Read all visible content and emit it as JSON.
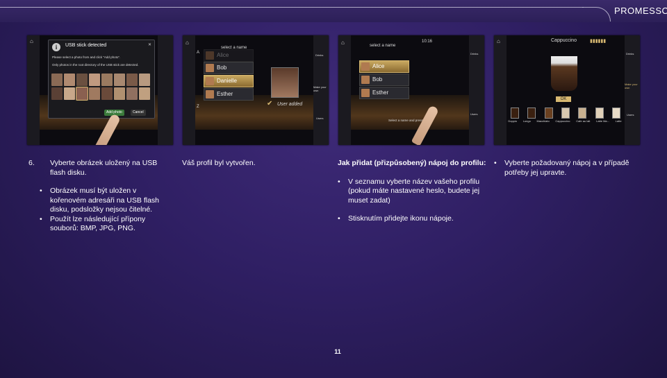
{
  "header": {
    "brand": "PROMESSO"
  },
  "screenshots": {
    "s1": {
      "dialog_title": "USB stick detected",
      "line1": "Please select a photo from and click \"Add photo\".",
      "line2": "Only photos in the root directory of the USB stick are detected.",
      "add_label": "Add photo",
      "cancel_label": "Cancel"
    },
    "s2": {
      "select_prompt": "select a name",
      "names": [
        "Alice",
        "Bob",
        "Danielle",
        "Esther"
      ],
      "user_added": "User added",
      "make_your_own": "Make your own",
      "drinks": "Drinks",
      "users": "Users"
    },
    "s3": {
      "time": "10:16",
      "select_prompt": "select a name",
      "names": [
        "Alice",
        "Bob",
        "Esther"
      ],
      "hint": "Select a name and press OK",
      "drinks": "Drinks",
      "users": "Users"
    },
    "s4": {
      "title": "Cappuccino",
      "ok": "OK",
      "drinks": [
        "Doppio",
        "Lungo",
        "Macchiato",
        "Cappuccino",
        "Cafe au lait",
        "Latte Ma...",
        "Latte"
      ],
      "side_drinks": "Drinks",
      "make_your_own": "Make your own",
      "users": "Users"
    }
  },
  "columns": {
    "c1": {
      "step": "6.",
      "main": "Vyberte obrázek uložený na USB flash disku.",
      "bullets": [
        "Obrázek musí být uložen v kořenovém adresáři na USB flash disku, podsložky nejsou čitelné.",
        "Použít lze následující přípony souborů: BMP, JPG, PNG."
      ]
    },
    "c2": {
      "text": "Váš profil byl vytvořen."
    },
    "c3": {
      "heading": "Jak přidat (přizpůsobený) nápoj do profilu:",
      "bullets": [
        "V seznamu vyberte název vašeho profilu (pokud máte nastavené heslo, budete jej muset zadat)",
        "Stisknutím přidejte ikonu nápoje."
      ]
    },
    "c4": {
      "bullets": [
        "Vyberte požadovaný nápoj a v případě potřeby jej upravte."
      ]
    }
  },
  "footer": {
    "page_number": "11"
  }
}
